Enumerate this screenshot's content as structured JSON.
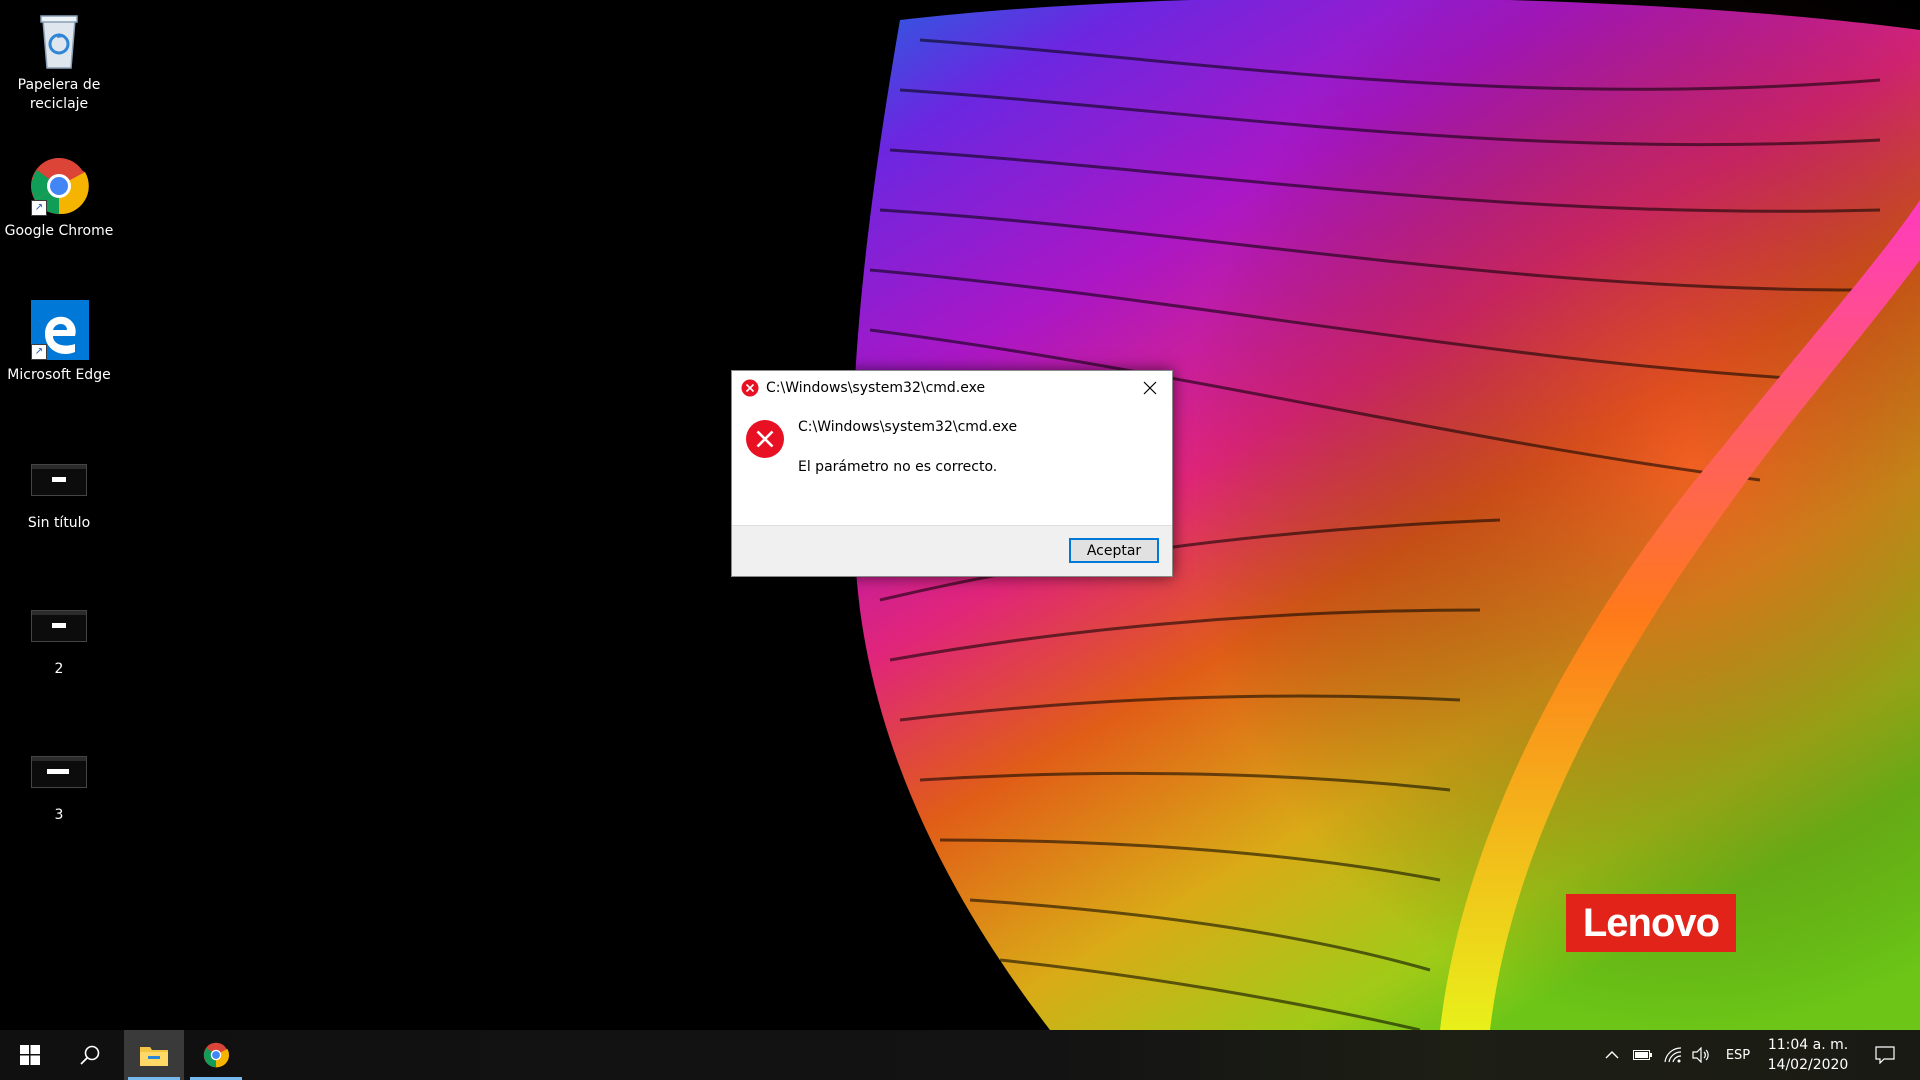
{
  "desktop": {
    "icons": [
      {
        "label": "Papelera de reciclaje",
        "icon": "recycle-bin-icon"
      },
      {
        "label": "Google Chrome",
        "icon": "chrome-icon"
      },
      {
        "label": "Microsoft Edge",
        "icon": "edge-icon"
      },
      {
        "label": "Sin título",
        "icon": "cmd-shortcut-icon"
      },
      {
        "label": "2",
        "icon": "cmd-shortcut-icon"
      },
      {
        "label": "3",
        "icon": "cmd-shortcut-icon"
      }
    ],
    "wallpaper_logo": "Lenovo"
  },
  "dialog": {
    "title": "C:\\Windows\\system32\\cmd.exe",
    "message_title": "C:\\Windows\\system32\\cmd.exe",
    "message_body": "El parámetro no es correcto.",
    "ok_label": "Aceptar",
    "error_color": "#e81123"
  },
  "taskbar": {
    "language": "ESP",
    "time": "11:04 a. m.",
    "date": "14/02/2020",
    "accent_color": "#76b9ed"
  }
}
